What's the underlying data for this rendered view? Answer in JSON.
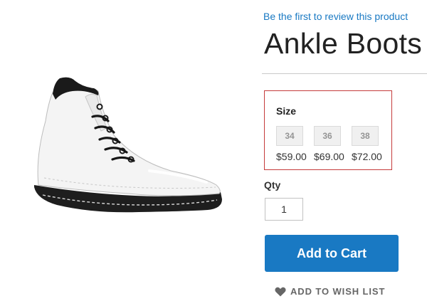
{
  "product": {
    "review_link": "Be the first to review this product",
    "title": "Ankle Boots",
    "image_alt": "white ankle boot"
  },
  "size": {
    "label": "Size",
    "options": [
      {
        "label": "34",
        "price": "$59.00"
      },
      {
        "label": "36",
        "price": "$69.00"
      },
      {
        "label": "38",
        "price": "$72.00"
      }
    ]
  },
  "qty": {
    "label": "Qty",
    "value": "1"
  },
  "actions": {
    "add_to_cart": "Add to Cart",
    "wish_list": "ADD TO WISH LIST"
  },
  "colors": {
    "accent": "#1979c3",
    "size_border": "#c53b3b"
  },
  "icons": {
    "wish": "heart-icon"
  }
}
